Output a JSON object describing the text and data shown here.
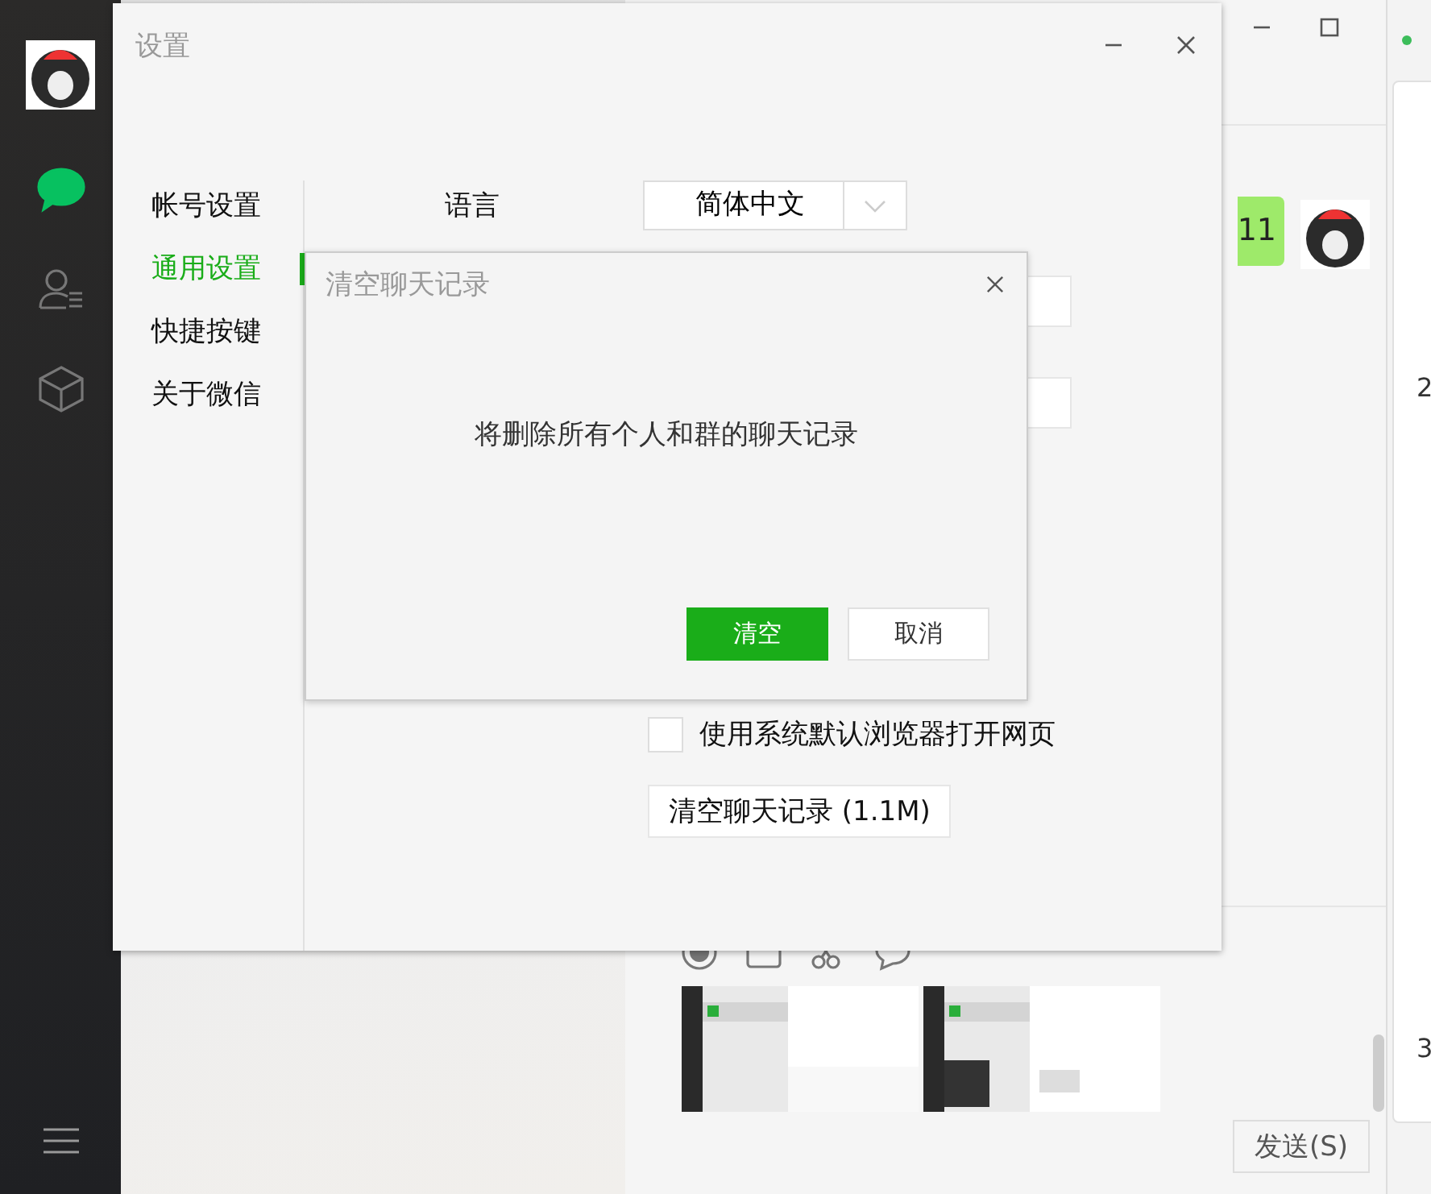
{
  "sidebar": {
    "nav": [
      {
        "kind": "chat",
        "selected": true
      },
      {
        "kind": "contacts",
        "selected": false
      },
      {
        "kind": "cube",
        "selected": false
      }
    ]
  },
  "chat": {
    "messages": [
      {
        "text": "11"
      }
    ],
    "send_button": "发送(S)"
  },
  "right_window": {
    "row_labels": [
      "2",
      "3"
    ]
  },
  "settings": {
    "title": "设置",
    "nav": [
      {
        "label": "帐号设置",
        "selected": false
      },
      {
        "label": "通用设置",
        "selected": true
      },
      {
        "label": "快捷按键",
        "selected": false
      },
      {
        "label": "关于微信",
        "selected": false
      }
    ],
    "language": {
      "label": "语言",
      "value": "简体中文"
    },
    "browser_option": {
      "label": "使用系统默认浏览器打开网页",
      "checked": false
    },
    "clear_button": "清空聊天记录 (1.1M)"
  },
  "dialog": {
    "title": "清空聊天记录",
    "message": "将删除所有个人和群的聊天记录",
    "buttons": [
      {
        "label": "清空",
        "kind": "primary"
      },
      {
        "label": "取消",
        "kind": "secondary"
      }
    ]
  }
}
